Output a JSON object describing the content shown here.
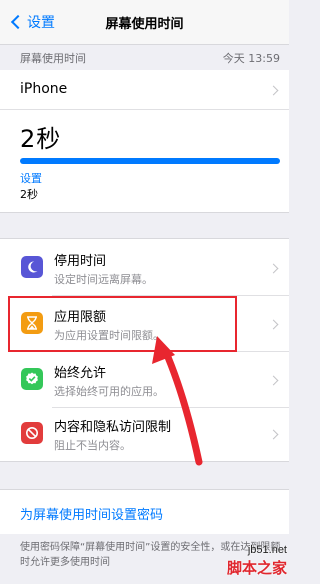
{
  "navbar": {
    "back_label": "设置",
    "title": "屏幕使用时间"
  },
  "usage_section": {
    "header_label": "屏幕使用时间",
    "timestamp": "今天 13:59",
    "device_name": "iPhone",
    "total_time": "2秒",
    "usage_fraction": 1.0,
    "category_label": "设置",
    "category_time": "2秒"
  },
  "settings": [
    {
      "title": "停用时间",
      "subtitle": "设定时间远离屏幕。",
      "icon": "moon-icon",
      "color": "#5856d6"
    },
    {
      "title": "应用限额",
      "subtitle": "为应用设置时间限额。",
      "icon": "hourglass-icon",
      "color": "#f39c12"
    },
    {
      "title": "始终允许",
      "subtitle": "选择始终可用的应用。",
      "icon": "checkmark-icon",
      "color": "#34c759"
    },
    {
      "title": "内容和隐私访问限制",
      "subtitle": "阻止不当内容。",
      "icon": "restriction-icon",
      "color": "#e23c3c"
    }
  ],
  "passcode": {
    "link_label": "为屏幕使用时间设置密码"
  },
  "footer": {
    "text": "使用密码保障“屏幕使用时间”设置的安全性，或在达到限额时允许更多使用时间"
  },
  "annotation": {
    "highlight_color": "#e8262f"
  },
  "watermark": {
    "site": "jb51.net",
    "name": "脚本之家"
  },
  "colors": {
    "accent": "#007aff",
    "background": "#efeff4"
  }
}
